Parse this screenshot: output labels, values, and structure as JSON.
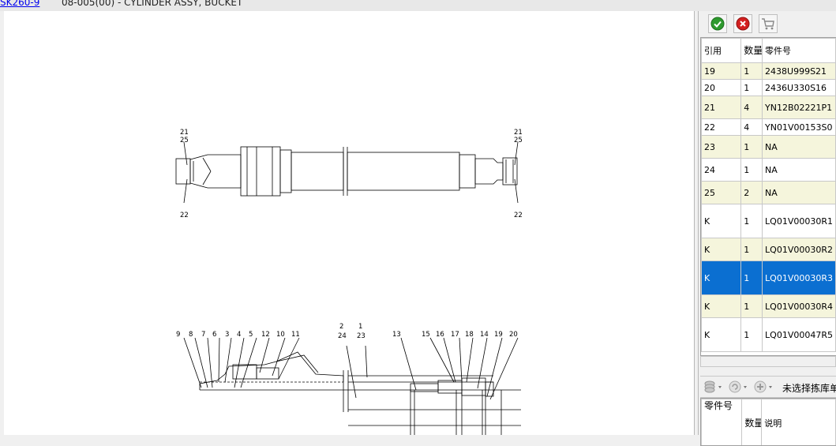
{
  "header": {
    "model_link": "SK260-9",
    "assembly_title": "08-005(00) - CYLINDER ASSY, BUCKET"
  },
  "toolbar": {
    "icons": [
      "confirm-check-icon",
      "cancel-x-icon",
      "cart-icon"
    ]
  },
  "parts_table": {
    "columns": {
      "ref": "引用",
      "qty": "数量",
      "part_no": "零件号"
    },
    "rows": [
      {
        "ref": "19",
        "qty": "1",
        "part_no": "2438U999S21"
      },
      {
        "ref": "20",
        "qty": "1",
        "part_no": "2436U330S16"
      },
      {
        "ref": "21",
        "qty": "4",
        "part_no": "YN12B02221P1"
      },
      {
        "ref": "22",
        "qty": "4",
        "part_no": "YN01V00153S0"
      },
      {
        "ref": "23",
        "qty": "1",
        "part_no": "NA"
      },
      {
        "ref": "24",
        "qty": "1",
        "part_no": "NA"
      },
      {
        "ref": "25",
        "qty": "2",
        "part_no": "NA"
      },
      {
        "ref": "K",
        "qty": "1",
        "part_no": "LQ01V00030R1"
      },
      {
        "ref": "K",
        "qty": "1",
        "part_no": "LQ01V00030R2"
      },
      {
        "ref": "K",
        "qty": "1",
        "part_no": "LQ01V00030R3"
      },
      {
        "ref": "K",
        "qty": "1",
        "part_no": "LQ01V00030R4"
      },
      {
        "ref": "K",
        "qty": "1",
        "part_no": "LQ01V00047R5"
      }
    ],
    "selected_row": 9
  },
  "picklist": {
    "filter_text": "未选择拣库单",
    "columns": {
      "part_no": "零件号",
      "qty": "数量",
      "description": "说明"
    }
  },
  "diagram": {
    "top_labels": {
      "left_top": "21",
      "left_mid": "25",
      "left_bottom": "22",
      "right_top": "21",
      "right_mid": "25",
      "right_bottom": "22"
    },
    "bottom_labels": {
      "n9": "9",
      "n8": "8",
      "n7": "7",
      "n6": "6",
      "n3": "3",
      "n4": "4",
      "n5": "5",
      "n12": "12",
      "n10": "10",
      "n11": "11",
      "n2": "2",
      "n24": "24",
      "n1": "1",
      "n23": "23",
      "n13": "13",
      "n15": "15",
      "n16": "16",
      "n17": "17",
      "n18": "18",
      "n14": "14",
      "n19": "19",
      "n20": "20"
    }
  }
}
